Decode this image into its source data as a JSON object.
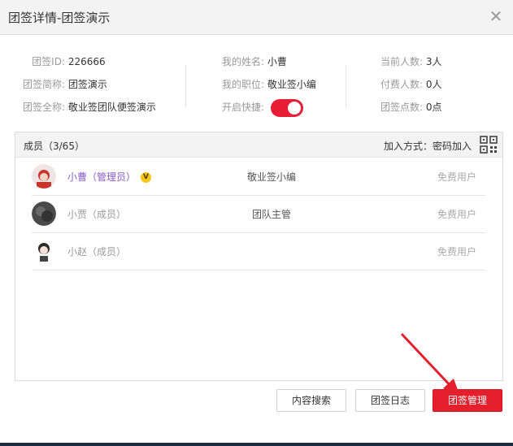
{
  "window": {
    "title": "团签详情-团签演示",
    "close_glyph": "✕"
  },
  "info": {
    "id_label": "团签ID:",
    "id_value": "226666",
    "short_name_label": "团签简称:",
    "short_name_value": "团签演示",
    "full_name_label": "团签全称:",
    "full_name_value": "敬业签团队便签演示",
    "my_name_label": "我的姓名:",
    "my_name_value": "小曹",
    "my_position_label": "我的职位:",
    "my_position_value": "敬业签小编",
    "shortcut_label": "开启快捷:",
    "shortcut_on": true,
    "current_count_label": "当前人数:",
    "current_count_value": "3人",
    "paid_count_label": "付费人数:",
    "paid_count_value": "0人",
    "points_label": "团签点数:",
    "points_value": "0点"
  },
  "members": {
    "title": "成员（3/65）",
    "join_method": "加入方式：密码加入",
    "qr_icon": "qr-code-icon",
    "rows": [
      {
        "name": "小曹（管理员）",
        "badge": "V",
        "role": "敬业签小编",
        "type": "免费用户",
        "name_color": "#8a5cc7"
      },
      {
        "name": "小贾（成员）",
        "role": "团队主管",
        "type": "免费用户",
        "name_color": "#999999"
      },
      {
        "name": "小赵（成员）",
        "role": "",
        "type": "免费用户",
        "name_color": "#999999"
      }
    ]
  },
  "buttons": {
    "search": "内容搜索",
    "log": "团签日志",
    "manage": "团签管理"
  },
  "colors": {
    "accent": "#e3202b",
    "toggle": "#e81e34",
    "admin_name": "#8a5cc7"
  }
}
